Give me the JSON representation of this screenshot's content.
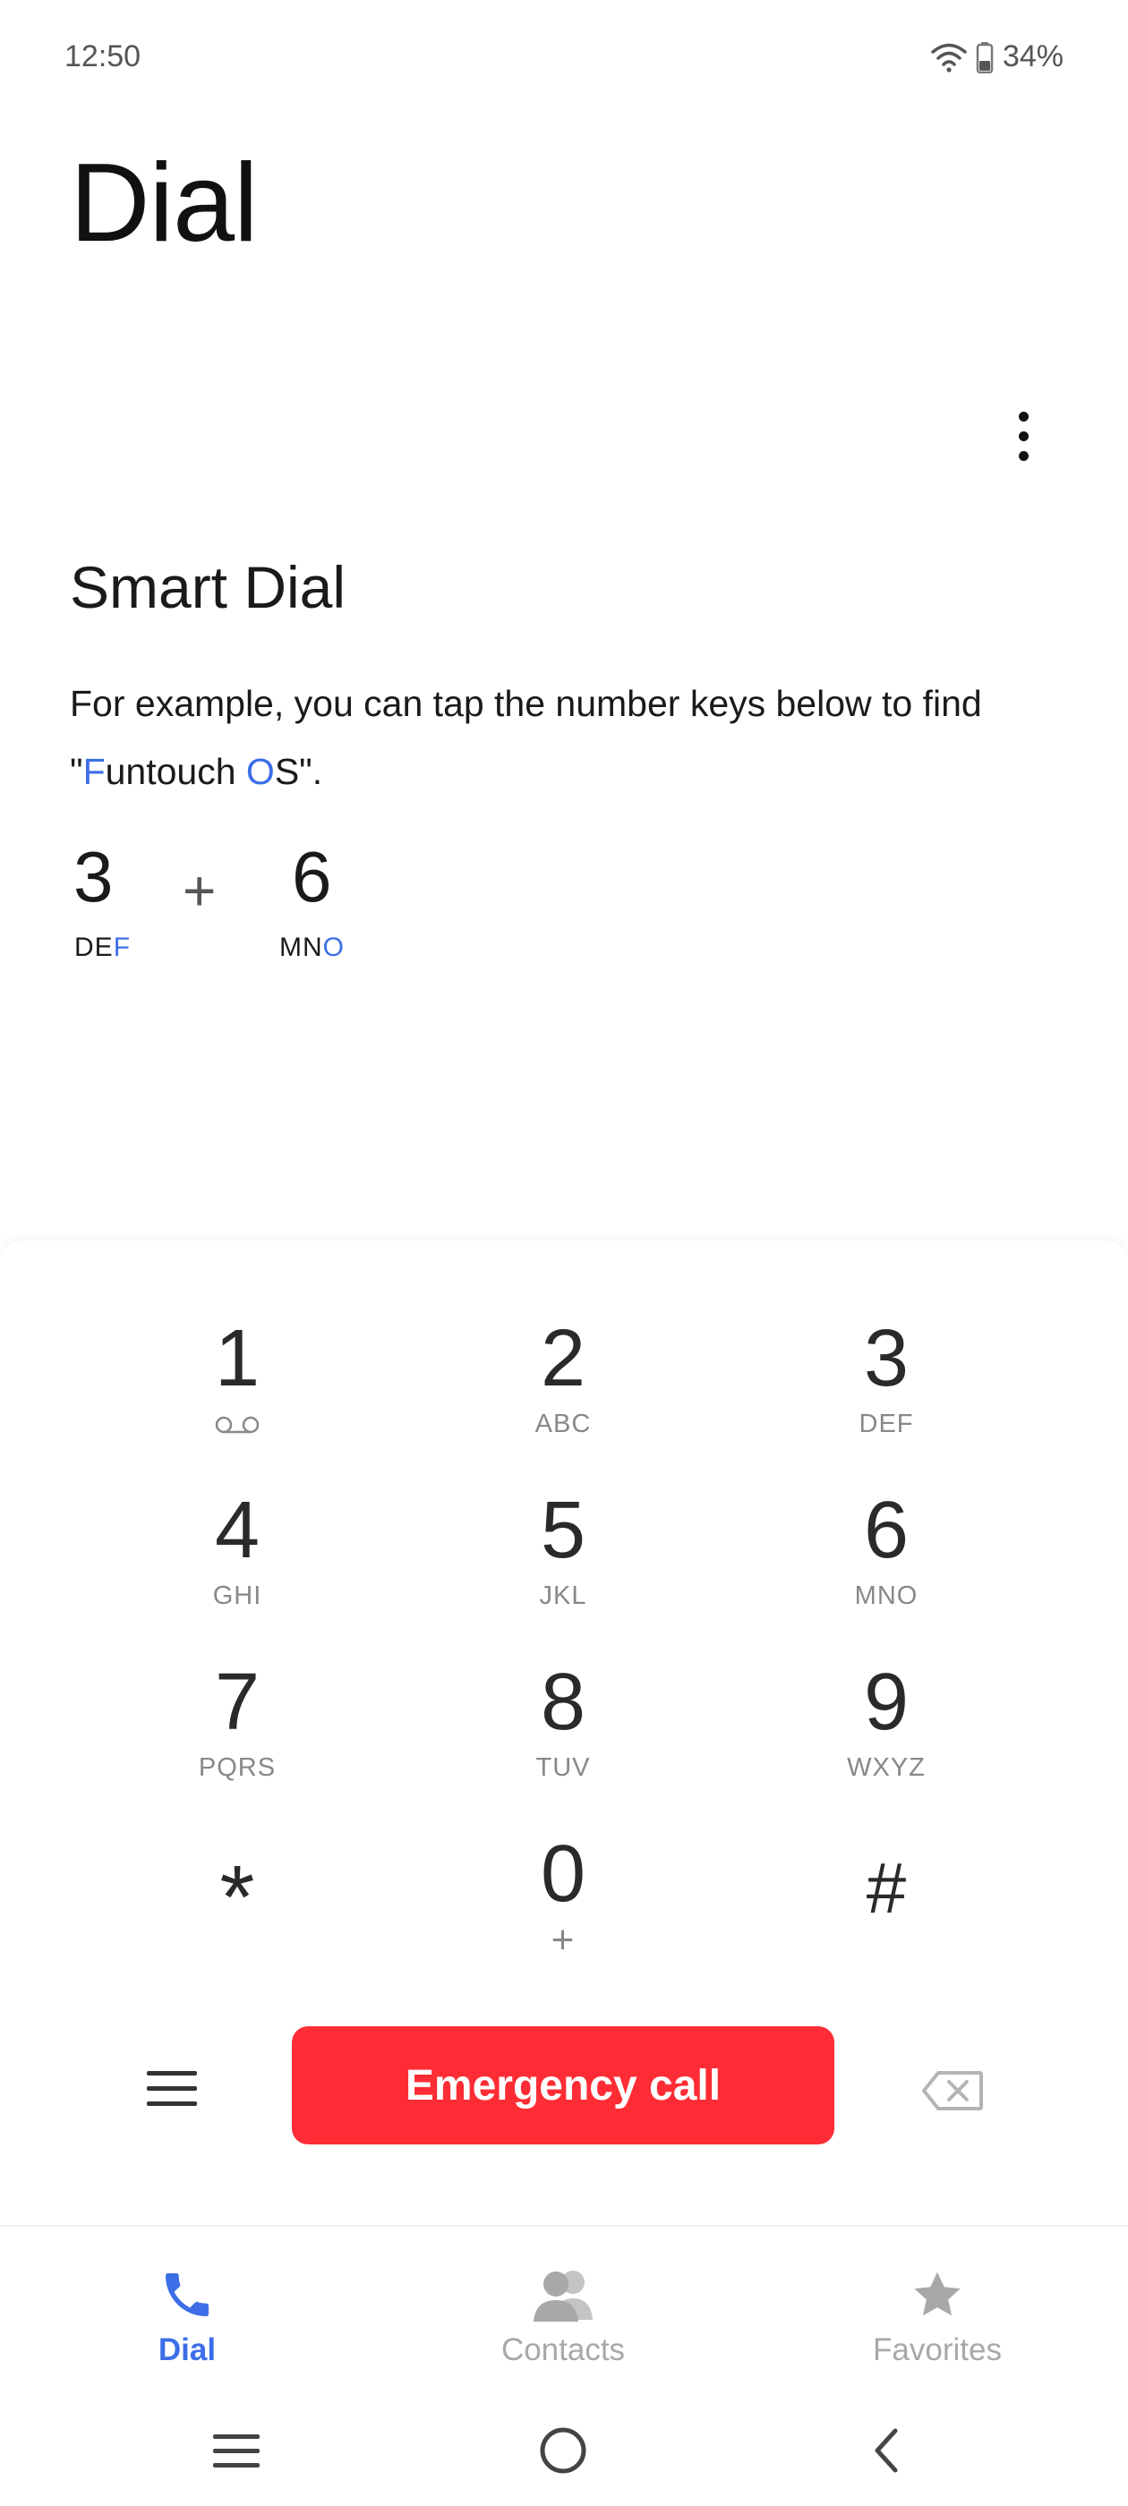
{
  "status_bar": {
    "time": "12:50",
    "battery": "34%"
  },
  "page_title": "Dial",
  "smart_dial": {
    "title": "Smart Dial",
    "desc_part1": "For example, you can tap the number keys below to find \"",
    "desc_f": "F",
    "desc_mid": "untouch ",
    "desc_o": "O",
    "desc_end": "S\".",
    "example": {
      "digit1": "3",
      "letters1_plain": "DE",
      "letters1_hl": "F",
      "plus": "+",
      "digit2": "6",
      "letters2_plain": "MN",
      "letters2_hl": "O"
    }
  },
  "keypad": [
    {
      "num": "1",
      "sub": ""
    },
    {
      "num": "2",
      "sub": "ABC"
    },
    {
      "num": "3",
      "sub": "DEF"
    },
    {
      "num": "4",
      "sub": "GHI"
    },
    {
      "num": "5",
      "sub": "JKL"
    },
    {
      "num": "6",
      "sub": "MNO"
    },
    {
      "num": "7",
      "sub": "PQRS"
    },
    {
      "num": "8",
      "sub": "TUV"
    },
    {
      "num": "9",
      "sub": "WXYZ"
    },
    {
      "num": "*",
      "sub": ""
    },
    {
      "num": "0",
      "sub": "+"
    },
    {
      "num": "#",
      "sub": ""
    }
  ],
  "emergency_label": "Emergency call",
  "tabs": [
    {
      "label": "Dial",
      "icon": "phone-icon",
      "active": true
    },
    {
      "label": "Contacts",
      "icon": "contacts-icon",
      "active": false
    },
    {
      "label": "Favorites",
      "icon": "star-icon",
      "active": false
    }
  ],
  "colors": {
    "accent": "#3d6ee8",
    "emergency": "#fe2d35",
    "inactive": "#a8a8a8"
  }
}
